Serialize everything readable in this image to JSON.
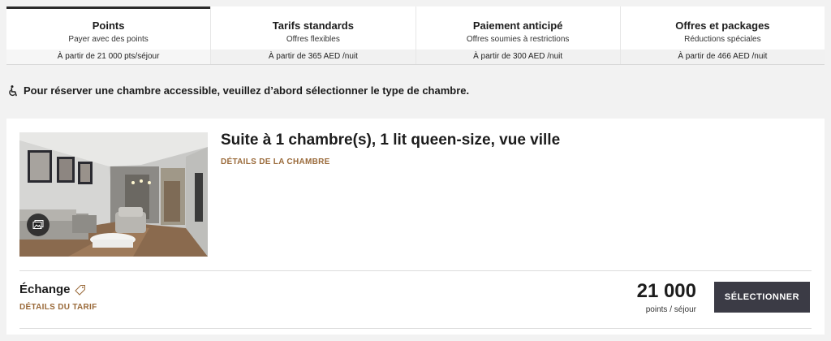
{
  "tabs": [
    {
      "title": "Points",
      "subtitle": "Payer avec des points",
      "price": "À partir de 21 000 pts/séjour",
      "active": true
    },
    {
      "title": "Tarifs standards",
      "subtitle": "Offres flexibles",
      "price": "À partir de 365 AED /nuit",
      "active": false
    },
    {
      "title": "Paiement anticipé",
      "subtitle": "Offres soumies à restrictions",
      "price": "À partir de 300 AED /nuit",
      "active": false
    },
    {
      "title": "Offres et packages",
      "subtitle": "Réductions spéciales",
      "price": "À partir de 466 AED /nuit",
      "active": false
    }
  ],
  "notice": {
    "icon": "wheelchair-icon",
    "text": "Pour réserver une chambre accessible, veuillez d’abord sélectionner le type de chambre."
  },
  "room": {
    "title": "Suite à 1 chambre(s), 1 lit queen-size, vue ville",
    "details_link": "DÉTAILS DE LA CHAMBRE",
    "gallery_icon": "photo-gallery-icon"
  },
  "rate": {
    "name": "Échange",
    "tag_icon": "tag-icon",
    "details_link": "DÉTAILS DU TARIF",
    "price_value": "21 000",
    "price_unit": "points / séjour",
    "select_label": "SÉLECTIONNER"
  },
  "colors": {
    "accent_link": "#9a6a3a",
    "button_bg": "#3b3b45",
    "page_bg": "#f2f2f2"
  }
}
